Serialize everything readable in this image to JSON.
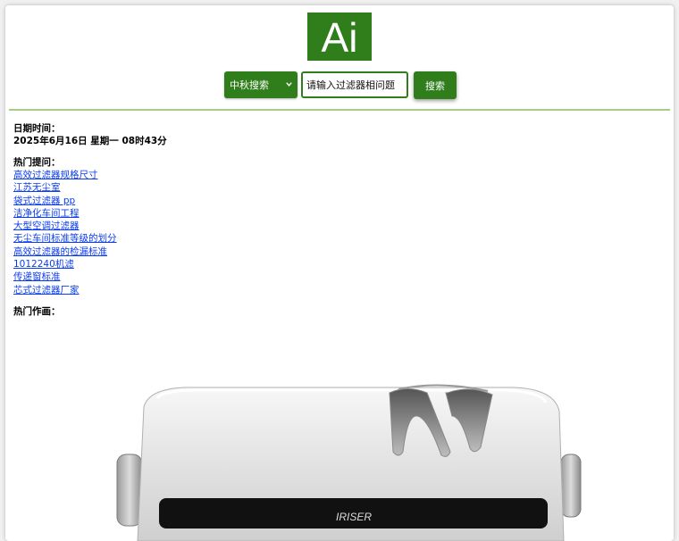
{
  "logo": {
    "text": "Ai",
    "color": "#2f7d1b"
  },
  "search": {
    "select_value": "中秋搜索",
    "input_value": "请输入过滤器相问题",
    "button_label": "搜索"
  },
  "datetime": {
    "label": "日期时间：",
    "value": "2025年6月16日 星期一 08时43分"
  },
  "hot_questions": {
    "label": "热门提问：",
    "items": [
      "高效过滤器规格尺寸",
      "江苏无尘室",
      "袋式过滤器 pp",
      "洁净化车间工程",
      "大型空调过滤器",
      "无尘车间标准等级的划分",
      "高效过滤器的检漏标准",
      "1012240机滤",
      "传递窗标准",
      "芯式过滤器厂家"
    ]
  },
  "hot_art": {
    "label": "热门作画：",
    "product_badge": "IRISER"
  }
}
